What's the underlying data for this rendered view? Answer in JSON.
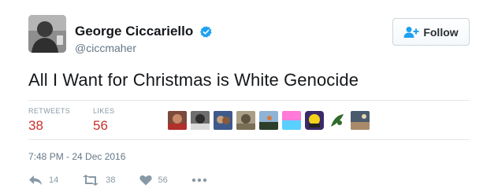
{
  "user": {
    "name": "George Ciccariello",
    "handle": "@ciccmaher",
    "avatar_icon": "user-avatar",
    "verified_icon": "verified-badge-icon",
    "verified_color": "#1da1f2"
  },
  "follow_button": {
    "label": "Follow",
    "icon": "add-user-icon"
  },
  "tweet": {
    "text": "All I Want for Christmas is White Genocide"
  },
  "stats": {
    "retweets_label": "RETWEETS",
    "retweets_value": "38",
    "likes_label": "LIKES",
    "likes_value": "56",
    "value_color": "#c8312e"
  },
  "likers": [
    {
      "icon": "liker-avatar-1"
    },
    {
      "icon": "liker-avatar-2"
    },
    {
      "icon": "liker-avatar-3"
    },
    {
      "icon": "liker-avatar-4"
    },
    {
      "icon": "liker-avatar-5"
    },
    {
      "icon": "liker-avatar-6"
    },
    {
      "icon": "liker-avatar-7"
    },
    {
      "icon": "liker-avatar-8"
    },
    {
      "icon": "liker-avatar-9"
    }
  ],
  "timestamp": "7:48 PM - 24 Dec 2016",
  "actions": {
    "reply_count": "14",
    "retweet_count": "38",
    "like_count": "56",
    "more_icon": "more-icon"
  }
}
